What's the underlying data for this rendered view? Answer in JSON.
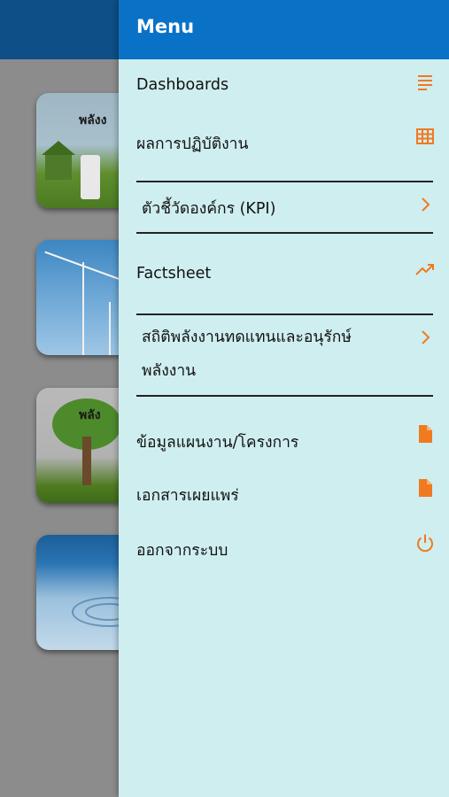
{
  "background": {
    "tiles": [
      {
        "label": "พลังง"
      },
      {
        "label": ""
      },
      {
        "label": "พลัง"
      },
      {
        "label": ""
      }
    ]
  },
  "menu": {
    "title": "Menu",
    "items": [
      {
        "label": "Dashboards",
        "icon": "list-lines-icon"
      },
      {
        "label": "ผลการปฏิบัติงาน",
        "icon": "grid-table-icon"
      },
      {
        "label": "ตัวชี้วัดองค์กร (KPI)",
        "icon": "chevron-right-icon"
      },
      {
        "label": "Factsheet",
        "icon": "trending-up-icon"
      },
      {
        "label": "สถิติพลังงานทดแทนและอนุรักษ์พลังงาน",
        "icon": "chevron-right-icon"
      },
      {
        "label": "ข้อมูลแผนงาน/โครงการ",
        "icon": "document-icon"
      },
      {
        "label": "เอกสารเผยแพร่",
        "icon": "document-icon"
      },
      {
        "label": "ออกจากระบบ",
        "icon": "power-icon"
      }
    ]
  },
  "colors": {
    "header": "#0a72c6",
    "drawer_bg": "#cfeef0",
    "icon_accent": "#f07a20"
  }
}
